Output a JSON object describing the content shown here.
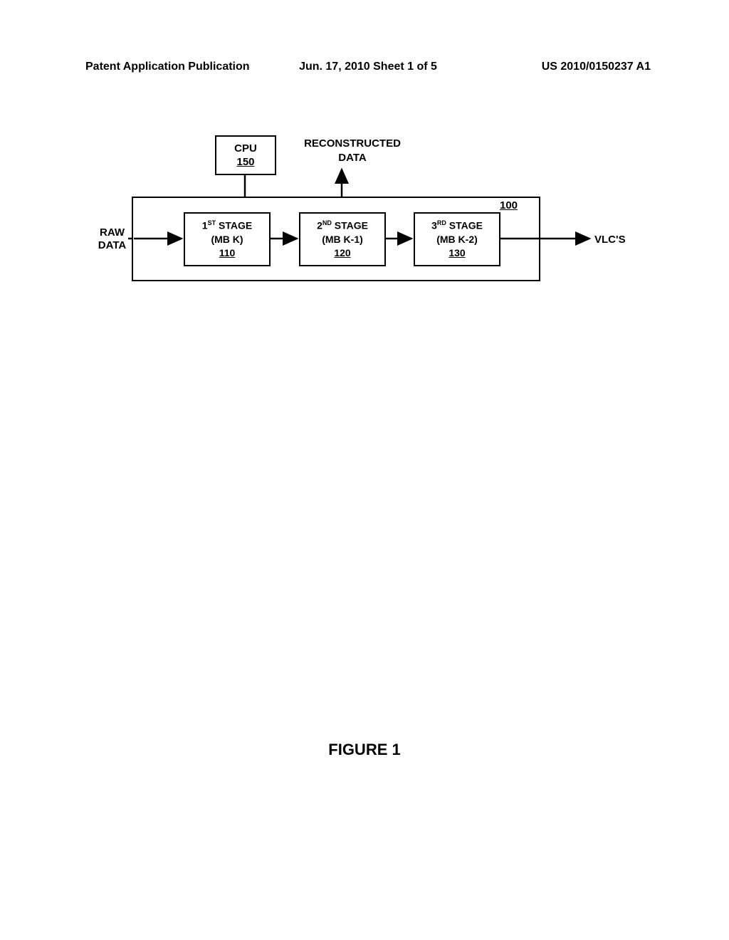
{
  "header": {
    "left": "Patent Application Publication",
    "center": "Jun. 17, 2010  Sheet 1 of 5",
    "right": "US 2010/0150237 A1"
  },
  "diagram": {
    "cpu": {
      "label": "CPU",
      "ref": "150"
    },
    "reconstructed": {
      "line1": "RECONSTRUCTED",
      "line2": "DATA"
    },
    "container_ref": "100",
    "raw": {
      "line1": "RAW",
      "line2": "DATA"
    },
    "vlc": "VLC'S",
    "stages": {
      "s1": {
        "prefix": "1",
        "ord": "ST",
        "suffix": " STAGE",
        "sub": "(MB K)",
        "ref": "110"
      },
      "s2": {
        "prefix": "2",
        "ord": "ND",
        "suffix": " STAGE",
        "sub": "(MB K-1)",
        "ref": "120"
      },
      "s3": {
        "prefix": "3",
        "ord": "RD",
        "suffix": " STAGE",
        "sub": "(MB K-2)",
        "ref": "130"
      }
    }
  },
  "figure_label": "FIGURE 1"
}
